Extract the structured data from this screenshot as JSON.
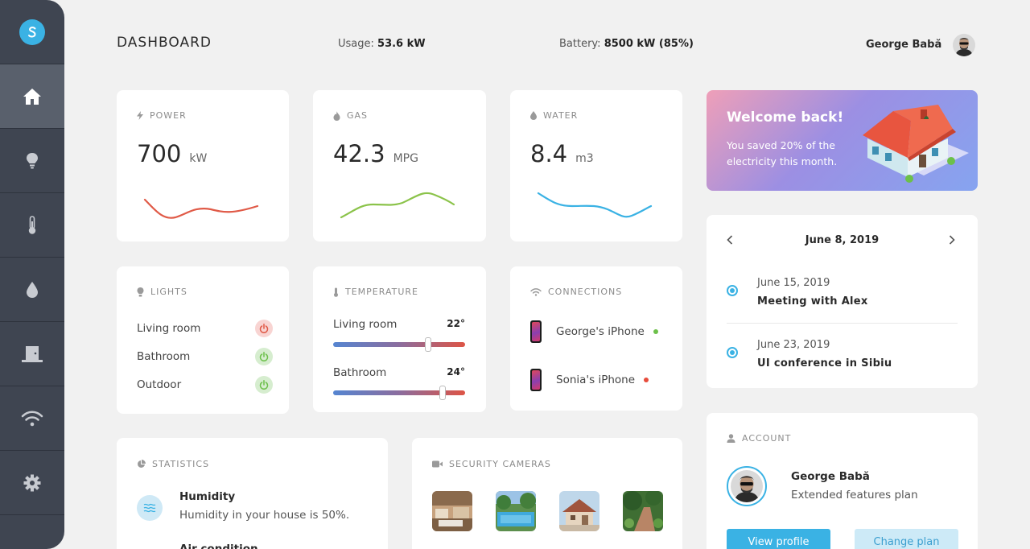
{
  "header": {
    "title": "DASHBOARD",
    "usage_label": "Usage:",
    "usage_value": "53.6 kW",
    "battery_label": "Battery:",
    "battery_value": "8500 kW (85%)",
    "user_name": "George Babă"
  },
  "sidebar": {
    "items": [
      {
        "name": "logo",
        "icon": "logo-s-icon"
      },
      {
        "name": "home",
        "icon": "home-icon",
        "active": true
      },
      {
        "name": "lights",
        "icon": "bulb-icon"
      },
      {
        "name": "temperature",
        "icon": "thermometer-icon"
      },
      {
        "name": "water",
        "icon": "drop-icon"
      },
      {
        "name": "door",
        "icon": "door-icon"
      },
      {
        "name": "wifi",
        "icon": "wifi-icon"
      },
      {
        "name": "settings",
        "icon": "gear-icon"
      }
    ]
  },
  "power": {
    "label": "POWER",
    "value": "700",
    "unit": "kW",
    "color": "#e05a47"
  },
  "gas": {
    "label": "GAS",
    "value": "42.3",
    "unit": "MPG",
    "color": "#8bc34a"
  },
  "water": {
    "label": "WATER",
    "value": "8.4",
    "unit": "m3",
    "color": "#3ab2e4"
  },
  "lights": {
    "label": "LIGHTS",
    "items": [
      {
        "name": "Living room",
        "state": "off"
      },
      {
        "name": "Bathroom",
        "state": "on"
      },
      {
        "name": "Outdoor",
        "state": "on"
      }
    ]
  },
  "temperature": {
    "label": "TEMPERATURE",
    "rooms": [
      {
        "name": "Living room",
        "value": "22°",
        "level": 0.72
      },
      {
        "name": "Bathroom",
        "value": "24°",
        "level": 0.83
      }
    ]
  },
  "connections": {
    "label": "CONNECTIONS",
    "devices": [
      {
        "name": "George's iPhone",
        "status": "online",
        "color": "#6cc04a"
      },
      {
        "name": "Sonia's iPhone",
        "status": "offline",
        "color": "#e74c3c"
      }
    ]
  },
  "welcome": {
    "title": "Welcome back!",
    "message": "You saved 20% of the electricity this month."
  },
  "calendar": {
    "date": "June 8, 2019",
    "events": [
      {
        "date": "June 15, 2019",
        "title": "Meeting with Alex"
      },
      {
        "date": "June 23, 2019",
        "title": "UI conference in Sibiu"
      }
    ]
  },
  "statistics": {
    "label": "STATISTICS",
    "items": [
      {
        "title": "Humidity",
        "desc": "Humidity in your house is 50%."
      },
      {
        "title": "Air condition",
        "desc": ""
      }
    ]
  },
  "cameras": {
    "label": "SECURITY CAMERAS",
    "count": 4
  },
  "account": {
    "label": "ACCOUNT",
    "name": "George Babă",
    "plan": "Extended features plan",
    "view_label": "View profile",
    "change_label": "Change plan"
  },
  "colors": {
    "accent": "#3ab2e4",
    "sidebar": "#3f4551",
    "sidebar_active": "#59606c"
  }
}
